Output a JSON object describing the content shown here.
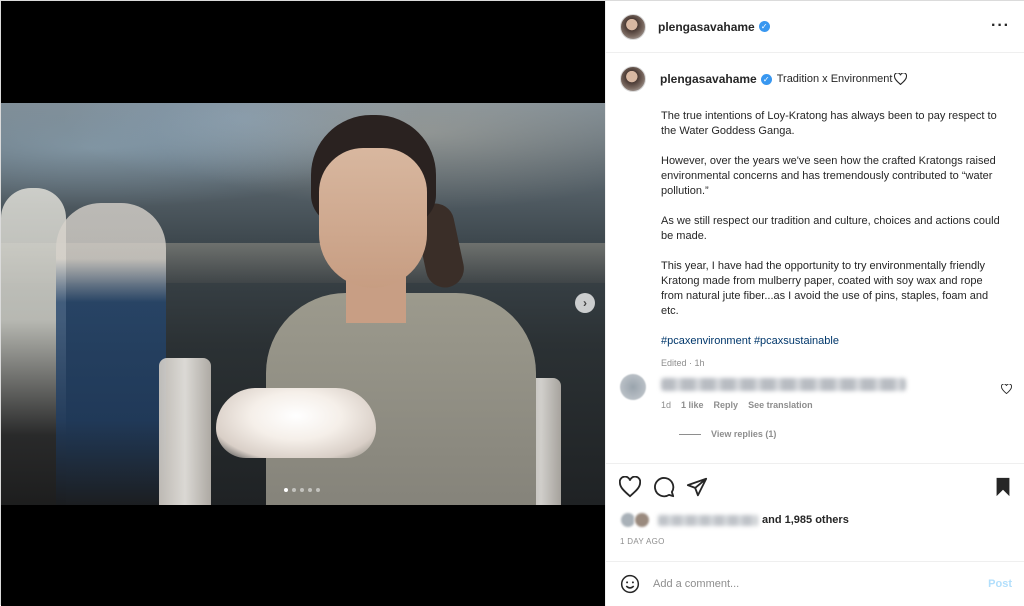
{
  "post": {
    "username": "plengasavahame",
    "location": "Tradition x Environment",
    "more_icon": "more-horizontal-icon",
    "caption_paragraphs": [
      "The true intentions of Loy-Kratong has always been to pay respect to the Water Goddess Ganga.",
      "However, over the years we've seen how the crafted Kratongs raised environmental concerns and has tremendously contributed to “water pollution.”",
      "As we still respect our tradition and culture, choices and actions could be made.",
      "This year, I have had the opportunity to try environmentally friendly Kratong made from mulberry paper, coated with soy wax and rope from natural jute fiber...as I avoid the use of pins, staples, foam and etc."
    ],
    "hashtags": "#pcaxenvironment #pcaxsustainable",
    "edited": "Edited · 1h"
  },
  "comment": {
    "time": "1d",
    "likes": "1 like",
    "reply": "Reply",
    "translate": "See translation",
    "view_replies": "View replies (1)"
  },
  "likes": {
    "and_others": "and 1,985 others"
  },
  "timestamp": "1 DAY AGO",
  "add_comment": {
    "placeholder": "Add a comment...",
    "post_label": "Post"
  },
  "media": {
    "slide_count": 5,
    "active_slide": 1
  },
  "colors": {
    "link": "#00376b",
    "verified": "#3897f0",
    "muted": "#8e8e8e",
    "post_disabled": "#b2dffc"
  }
}
